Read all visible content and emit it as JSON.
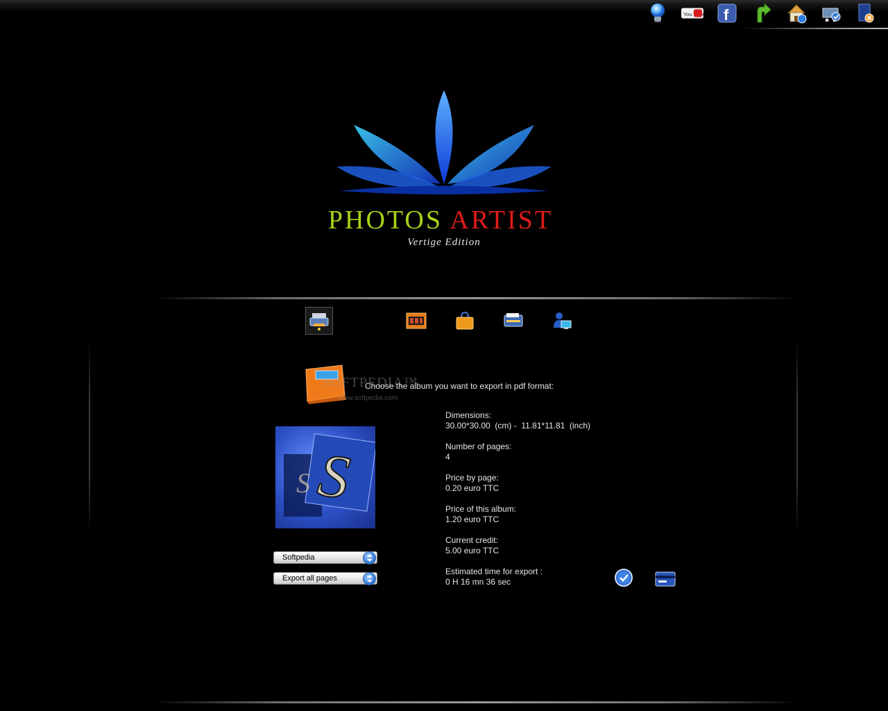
{
  "top_icons": [
    {
      "name": "lightbulb-icon"
    },
    {
      "name": "youtube-icon",
      "text": "You Tube"
    },
    {
      "name": "facebook-icon",
      "text": "f"
    },
    {
      "name": "update-arrow-icon"
    },
    {
      "name": "home-icon"
    },
    {
      "name": "cart-icon"
    },
    {
      "name": "exit-icon"
    }
  ],
  "logo": {
    "title_word1": "PHOTOS",
    "title_word2": "ARTIST",
    "subtitle": "Vertige Edition",
    "colors": {
      "word1": "#a8d41a",
      "word2": "#e01b1b"
    }
  },
  "tabs": [
    {
      "name": "print-tab-icon",
      "active": true
    },
    {
      "name": "film-strip-tab-icon",
      "active": false
    },
    {
      "name": "shopping-bag-tab-icon",
      "active": false
    },
    {
      "name": "scanner-tab-icon",
      "active": false
    },
    {
      "name": "user-computer-tab-icon",
      "active": false
    }
  ],
  "export": {
    "prompt": "Choose the album you want to export in pdf format:",
    "watermark": "SOFTPEDIA™",
    "watermark_url": "www.softpedia.com",
    "album_select": "Softpedia",
    "pages_select": "Export all pages"
  },
  "info": [
    {
      "label": "Dimensions:",
      "value": "30.00*30.00  (cm) -  11.81*11.81  (inch)"
    },
    {
      "label": "Number of pages:",
      "value": "4"
    },
    {
      "label": "Price by page:",
      "value": "0.20 euro TTC"
    },
    {
      "label": "Price of this album:",
      "value": "1.20 euro TTC"
    },
    {
      "label": "Current credit:",
      "value": "5.00 euro TTC"
    },
    {
      "label": "Estimated time for export :",
      "value": "0 H 16 mn 36 sec"
    }
  ]
}
